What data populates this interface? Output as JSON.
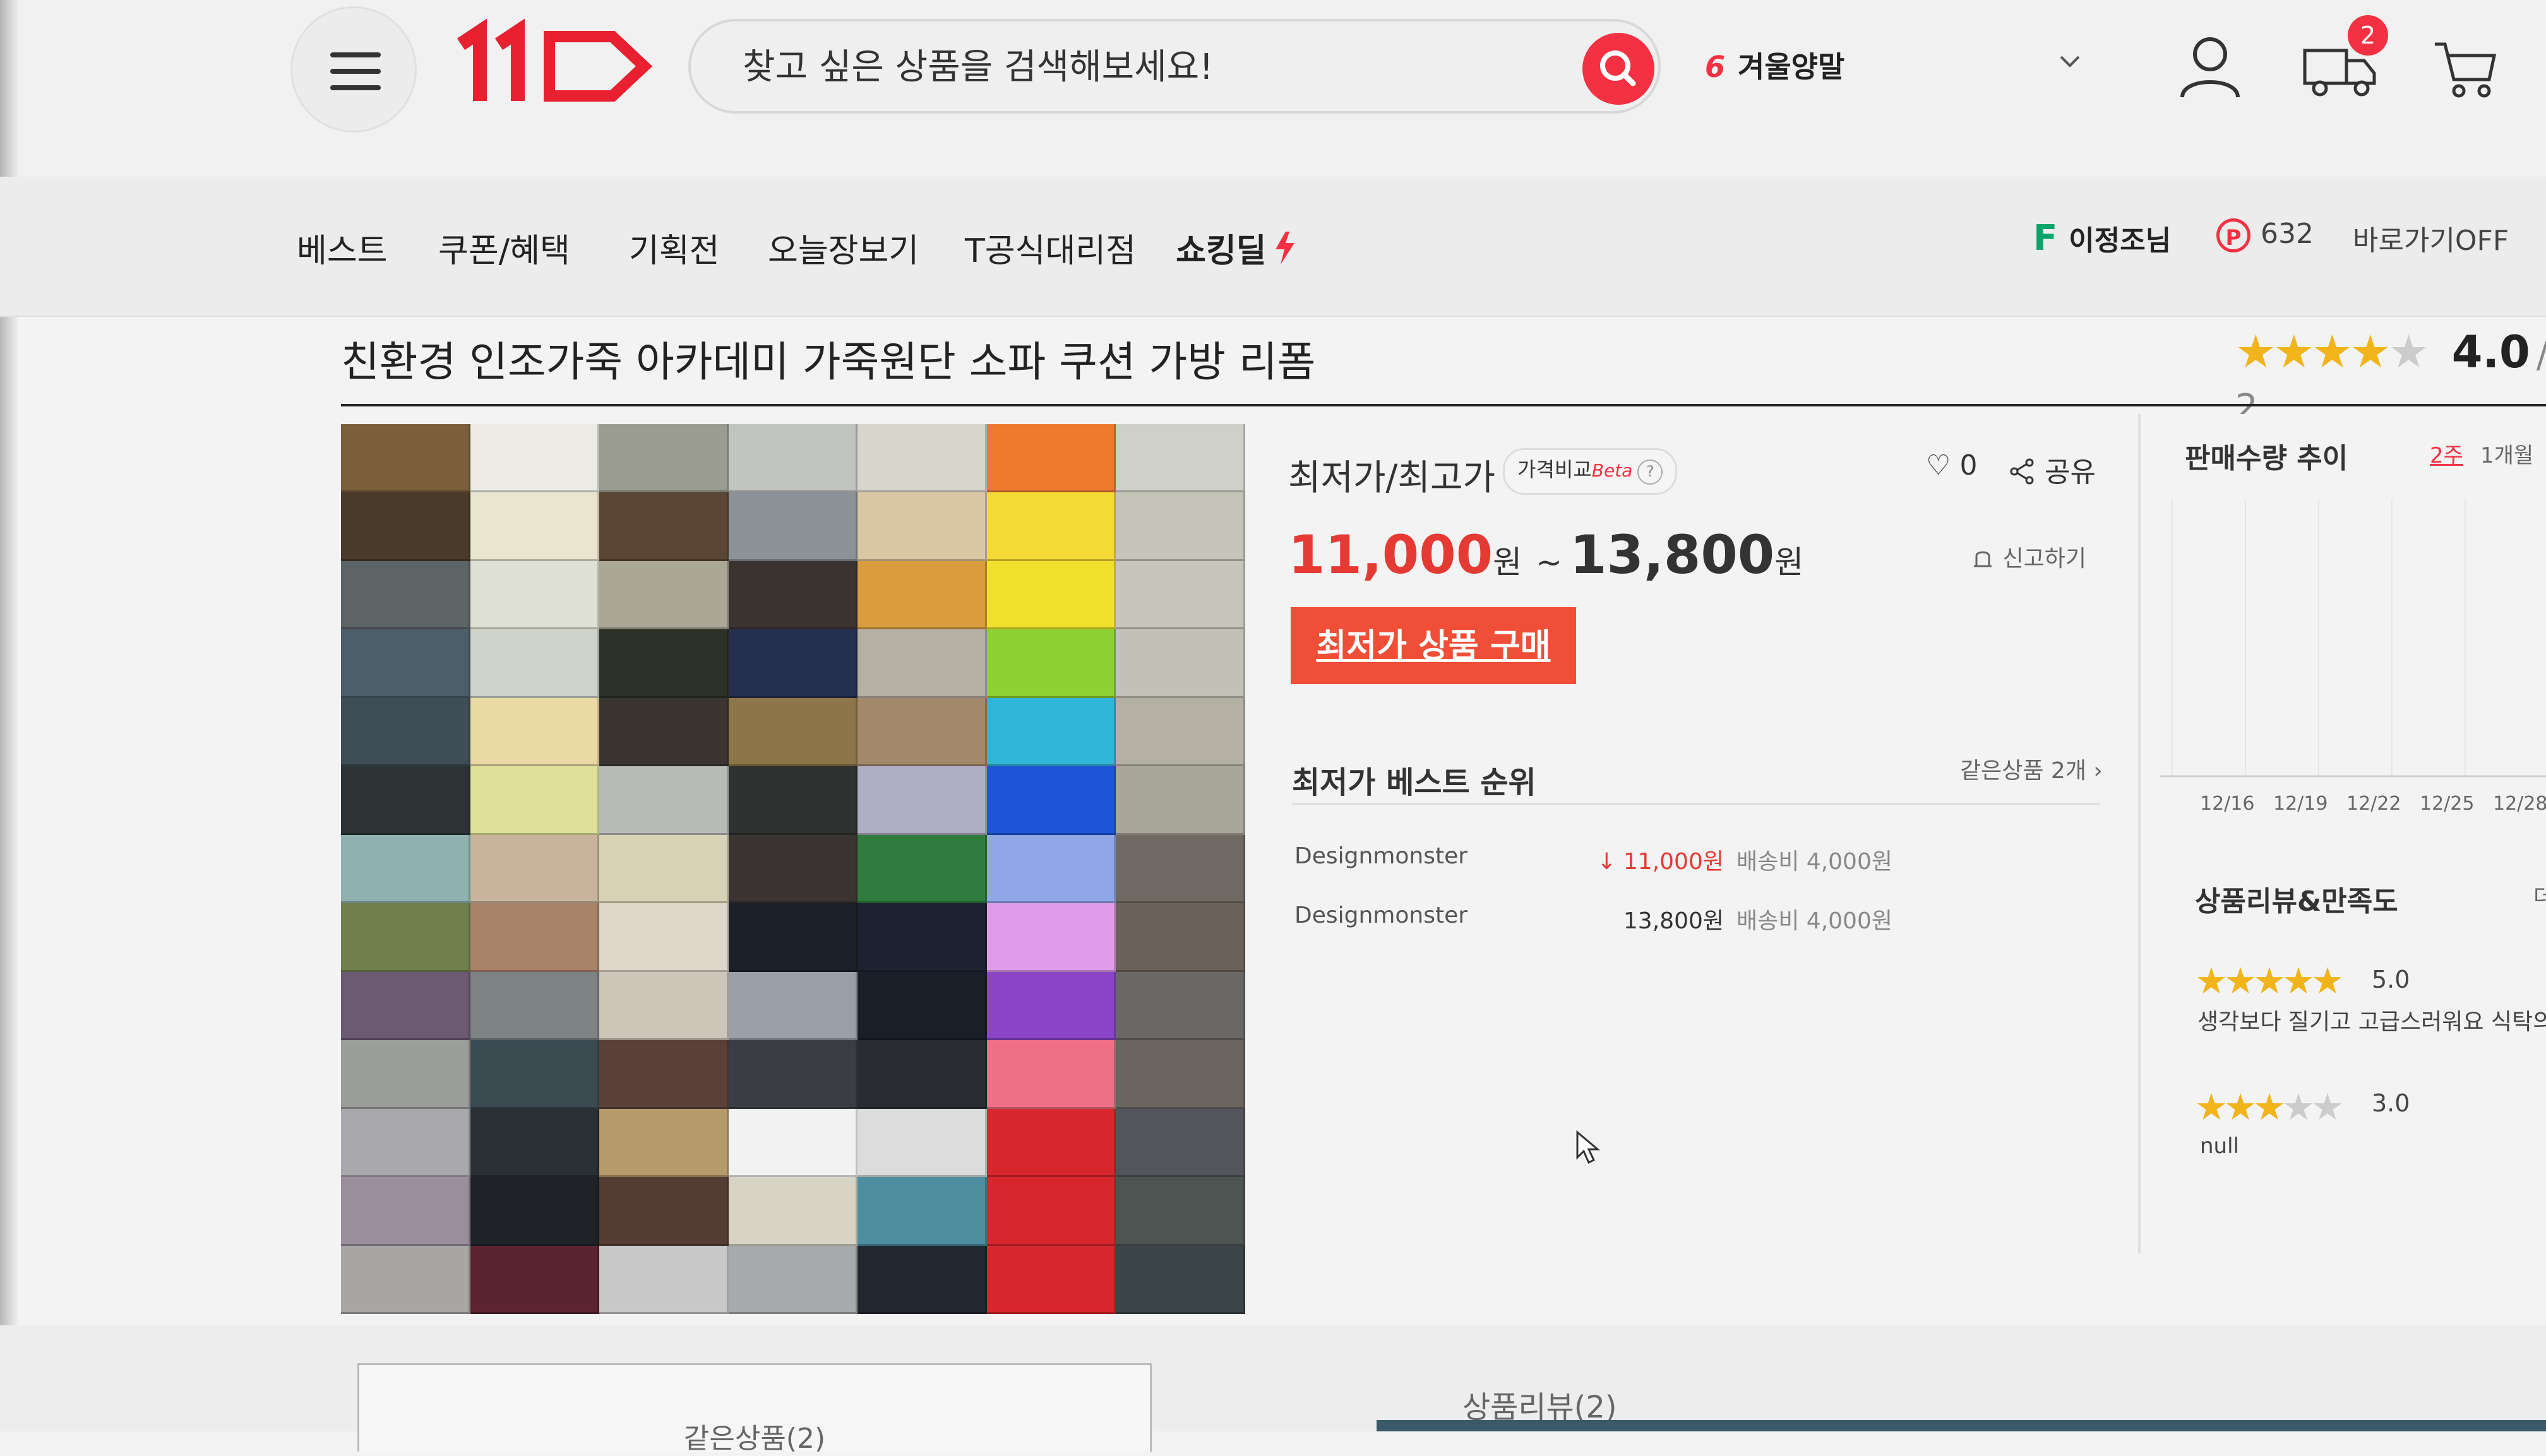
{
  "header": {
    "search_placeholder": "찾고 싶은 상품을 검색해보세요!",
    "trending_rank": "6",
    "trending_keyword": "겨울양말",
    "cart_badge": "2"
  },
  "nav": {
    "items": [
      "베스트",
      "쿠폰/혜택",
      "기획전",
      "오늘장보기",
      "T공식대리점",
      "쇼킹딜"
    ],
    "user_name": "이정조님",
    "points": "632",
    "shortcut": "바로가기OFF"
  },
  "product": {
    "title": "친환경 인조가죽 아카데미 가죽원단 소파 쿠션 가방 리폼",
    "rating": "4.0",
    "rating_suffix": "/ 2",
    "price_label": "최저가/최고가",
    "compare_badge": "가격비교",
    "compare_beta": "Beta",
    "likes": "0",
    "share": "공유",
    "price_low": "11,000",
    "price_high": "13,800",
    "won": "원",
    "tilde": "~",
    "report": "신고하기",
    "buy_button": "최저가 상품 구매"
  },
  "best_ranking": {
    "title": "최저가 베스트 순위",
    "same_products": "같은상품 2개",
    "rows": [
      {
        "seller": "Designmonster",
        "price": "↓ 11,000원",
        "shipping": "배송비 4,000원"
      },
      {
        "seller": "Designmonster",
        "price": "13,800원",
        "shipping": "배송비 4,000원"
      }
    ]
  },
  "sidebar": {
    "trend_title": "판매수량 추이",
    "period_2w": "2주",
    "period_1m": "1개월",
    "dates": [
      "12/16",
      "12/19",
      "12/22",
      "12/25",
      "12/28"
    ],
    "review_title": "상품리뷰&만족도",
    "review_more": "더",
    "reviews": [
      {
        "score": "5.0",
        "text": "생각보다 질기고 고급스러워요 식탁의자"
      },
      {
        "score": "3.0",
        "text": "null"
      }
    ]
  },
  "tabs": {
    "same_products": "같은상품(2)",
    "reviews": "상품리뷰(2)"
  },
  "colors": {
    "accent": "#f43142",
    "buy_button": "#f04e37",
    "star": "#f1b41a",
    "points_f": "#0aa46a"
  },
  "swatch_columns": [
    [
      "#7a5f3a",
      "#4a3a2c",
      "#5d6466",
      "#4b5e69",
      "#3f4d56",
      "#2c3436",
      "#8fb2b0",
      "#6f7f4e",
      "#6b5a72",
      "#9a9d99",
      "#a9a8ad",
      "#9b8e9c",
      "#a7a6a4"
    ],
    [
      "#ecebe4",
      "#e9e5cf",
      "#dfe1d6",
      "#cfd3c9",
      "#ead9a4",
      "#dfe19a",
      "#c8b49c",
      "#a9826a",
      "#7d8284",
      "#3c4a52",
      "#2b3035",
      "#1f2227",
      "#5c2430"
    ],
    [
      "#9a9c92",
      "#5a4632",
      "#aaa894",
      "#2d3127",
      "#3a3530",
      "#b8bab8",
      "#d8d3b6",
      "#ddd6c9",
      "#cfc4b8",
      "#5a4038",
      "#b59a6c",
      "#553c34",
      "#c8c8c8"
    ],
    [
      "#c2c4c0",
      "#8d9298",
      "#3a3330",
      "#25304f",
      "#8c7548",
      "#2e3230",
      "#3b3432",
      "#1c2028",
      "#9ba0a8",
      "#3a3e44",
      "#f2f2f2",
      "#d7d4c6",
      "#a7a9ab"
    ],
    [
      "#d8d6cc",
      "#d9c7a4",
      "#d99c3e",
      "#b5b0a4",
      "#a4886c",
      "#b0aec4",
      "#2e7d3e",
      "#1d2230",
      "#1a1e28",
      "#292c33",
      "#dcdcdc",
      "#4c8ea0",
      "#222730"
    ],
    [
      "#ee7a30",
      "#f5d934",
      "#f0e12c",
      "#8ed132",
      "#30b6d8",
      "#1d55d8",
      "#90a6e6",
      "#e09cea",
      "#8a44c8",
      "#ef6f86",
      "#d8262d",
      "#d8262d",
      "#d8262d"
    ],
    [
      "#cfd0c8",
      "#c4c4b8",
      "#c6c6bc",
      "#c2c1b5",
      "#b4b1a4",
      "#a9a69a",
      "#6f6a63",
      "#6a6258",
      "#696866",
      "#6c6460",
      "#54545c",
      "#4d5452",
      "#3a4449"
    ]
  ]
}
